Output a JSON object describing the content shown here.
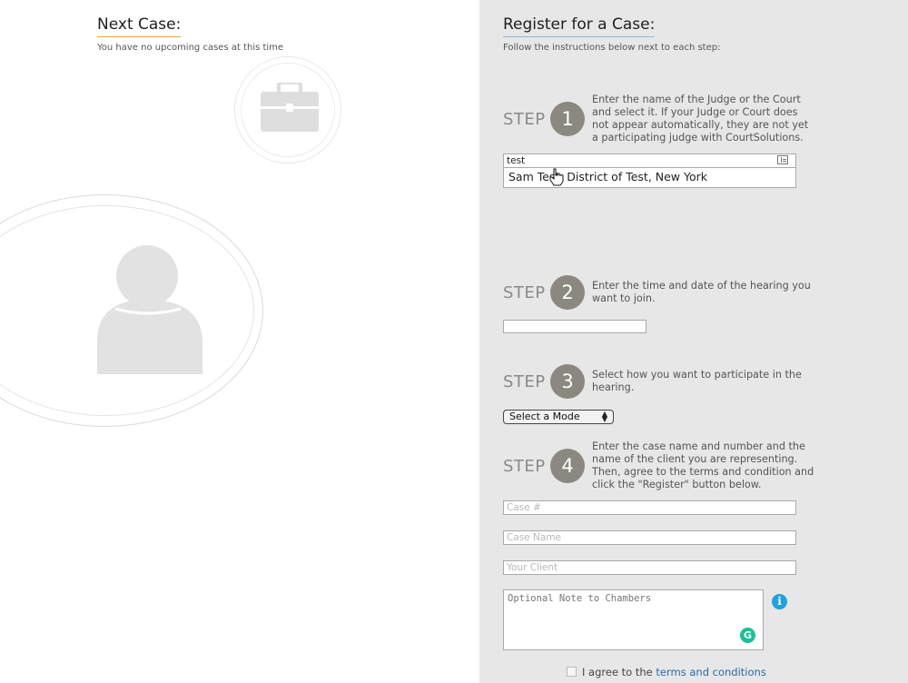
{
  "next_case": {
    "title": "Next Case:",
    "empty_message": "You have no upcoming cases at this time",
    "briefcase_icon": "briefcase-icon",
    "avatar_icon": "user-avatar-icon"
  },
  "register": {
    "title": "Register for a Case:",
    "instructions": "Follow the instructions below next to each step:",
    "step_word": "STEP",
    "steps": [
      {
        "number": "1",
        "text": "Enter the name of the Judge or the Court and select it. If your Judge or Court does not appear automatically, they are not yet a participating judge with CourtSolutions."
      },
      {
        "number": "2",
        "text": "Enter the time and date of the hearing you want to join."
      },
      {
        "number": "3",
        "text": "Select how you want to participate in the hearing."
      },
      {
        "number": "4",
        "text": "Enter the case name and number and the name of the client you are representing. Then, agree to the terms and condition and click the \"Register\" button below."
      }
    ],
    "judge_search": {
      "value": "test",
      "suggestion": "Sam Test, District of Test, New York"
    },
    "datetime": {
      "value": ""
    },
    "mode_select": {
      "selected": "Select a Mode"
    },
    "case_number": {
      "placeholder": "Case #"
    },
    "case_name": {
      "placeholder": "Case Name"
    },
    "client": {
      "placeholder": "Your Client"
    },
    "note": {
      "placeholder": "Optional Note to Chambers"
    },
    "agree": {
      "text": "I agree to the",
      "link": "terms and conditions"
    }
  },
  "colors": {
    "accent_underline_left": "#e8a046",
    "accent_underline_right": "#8fb5d8",
    "step_circle": "#8b8880",
    "info": "#1fa2e0",
    "grammarly": "#15c39a",
    "link": "#2b6aa8"
  }
}
